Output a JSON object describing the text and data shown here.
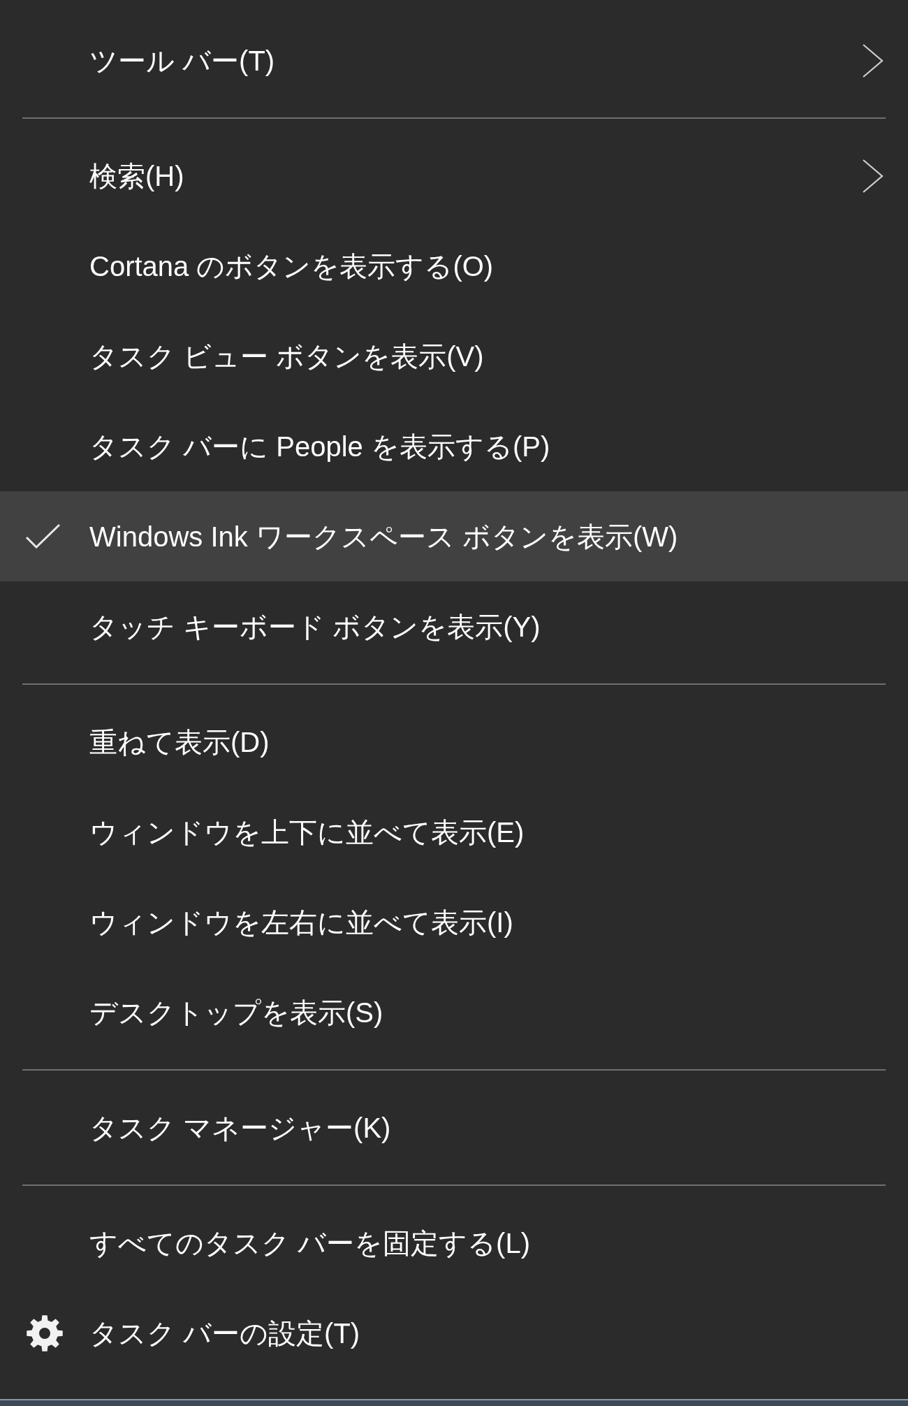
{
  "menu": {
    "groups": [
      {
        "items": [
          {
            "kind": "command",
            "label": "ツール バー(T)",
            "checked": false,
            "selected": false,
            "submenu": true
          }
        ]
      },
      {
        "items": [
          {
            "kind": "command",
            "label": "検索(H)",
            "checked": false,
            "selected": false,
            "submenu": true
          },
          {
            "kind": "command",
            "label": "Cortana のボタンを表示する(O)",
            "checked": false,
            "selected": false,
            "submenu": false
          },
          {
            "kind": "command",
            "label": "タスク ビュー ボタンを表示(V)",
            "checked": false,
            "selected": false,
            "submenu": false
          },
          {
            "kind": "command",
            "label": "タスク バーに People を表示する(P)",
            "checked": false,
            "selected": false,
            "submenu": false
          },
          {
            "kind": "command",
            "label": "Windows Ink ワークスペース ボタンを表示(W)",
            "checked": true,
            "selected": true,
            "submenu": false
          },
          {
            "kind": "command",
            "label": "タッチ キーボード ボタンを表示(Y)",
            "checked": false,
            "selected": false,
            "submenu": false
          }
        ]
      },
      {
        "items": [
          {
            "kind": "command",
            "label": "重ねて表示(D)",
            "checked": false,
            "selected": false,
            "submenu": false
          },
          {
            "kind": "command",
            "label": "ウィンドウを上下に並べて表示(E)",
            "checked": false,
            "selected": false,
            "submenu": false
          },
          {
            "kind": "command",
            "label": "ウィンドウを左右に並べて表示(I)",
            "checked": false,
            "selected": false,
            "submenu": false
          },
          {
            "kind": "command",
            "label": "デスクトップを表示(S)",
            "checked": false,
            "selected": false,
            "submenu": false
          }
        ]
      },
      {
        "items": [
          {
            "kind": "command",
            "label": "タスク マネージャー(K)",
            "checked": false,
            "selected": false,
            "submenu": false
          }
        ]
      },
      {
        "items": [
          {
            "kind": "command",
            "label": "すべてのタスク バーを固定する(L)",
            "checked": false,
            "selected": false,
            "submenu": false
          },
          {
            "kind": "settings",
            "label": "タスク バーの設定(T)",
            "checked": false,
            "selected": false,
            "submenu": false
          }
        ]
      }
    ]
  }
}
